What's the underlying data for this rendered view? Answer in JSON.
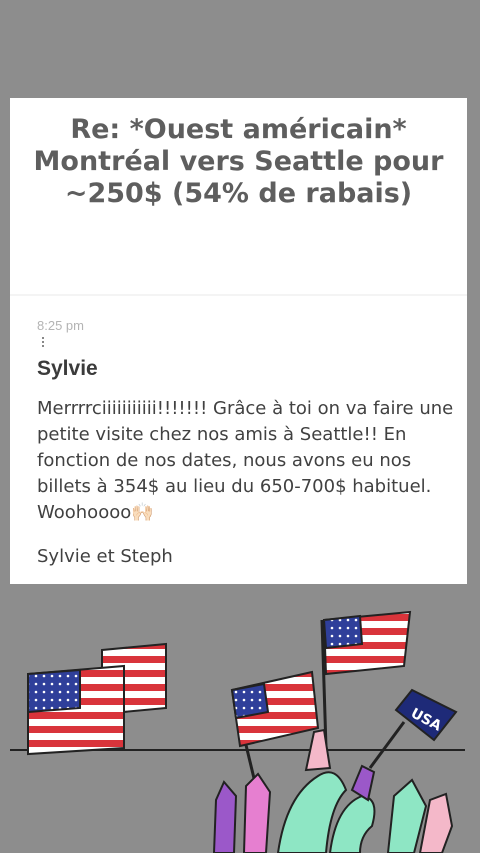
{
  "post": {
    "title": "Re: *Ouest américain* Montréal vers Seattle pour ~250$ (54% de rabais)"
  },
  "comment": {
    "time": "8:25 pm",
    "author": "Sylvie",
    "body": "Merrrrciiiiiiiiiii!!!!!!! Grâce à toi on va faire une petite visite chez nos amis à Seattle!! En fonction de nos dates, nous avons eu nos billets à 354$ au lieu du 650-700$ habituel. Woohoooo🙌🏻",
    "signature": "Sylvie et Steph"
  },
  "sticker": {
    "banner_text": "USA"
  },
  "colors": {
    "background": "#8d8d8d",
    "card": "#ffffff",
    "title": "#5e5e5e",
    "flag_red": "#d9343b",
    "flag_blue": "#2f3f9a",
    "banner_navy": "#1e2a78"
  }
}
